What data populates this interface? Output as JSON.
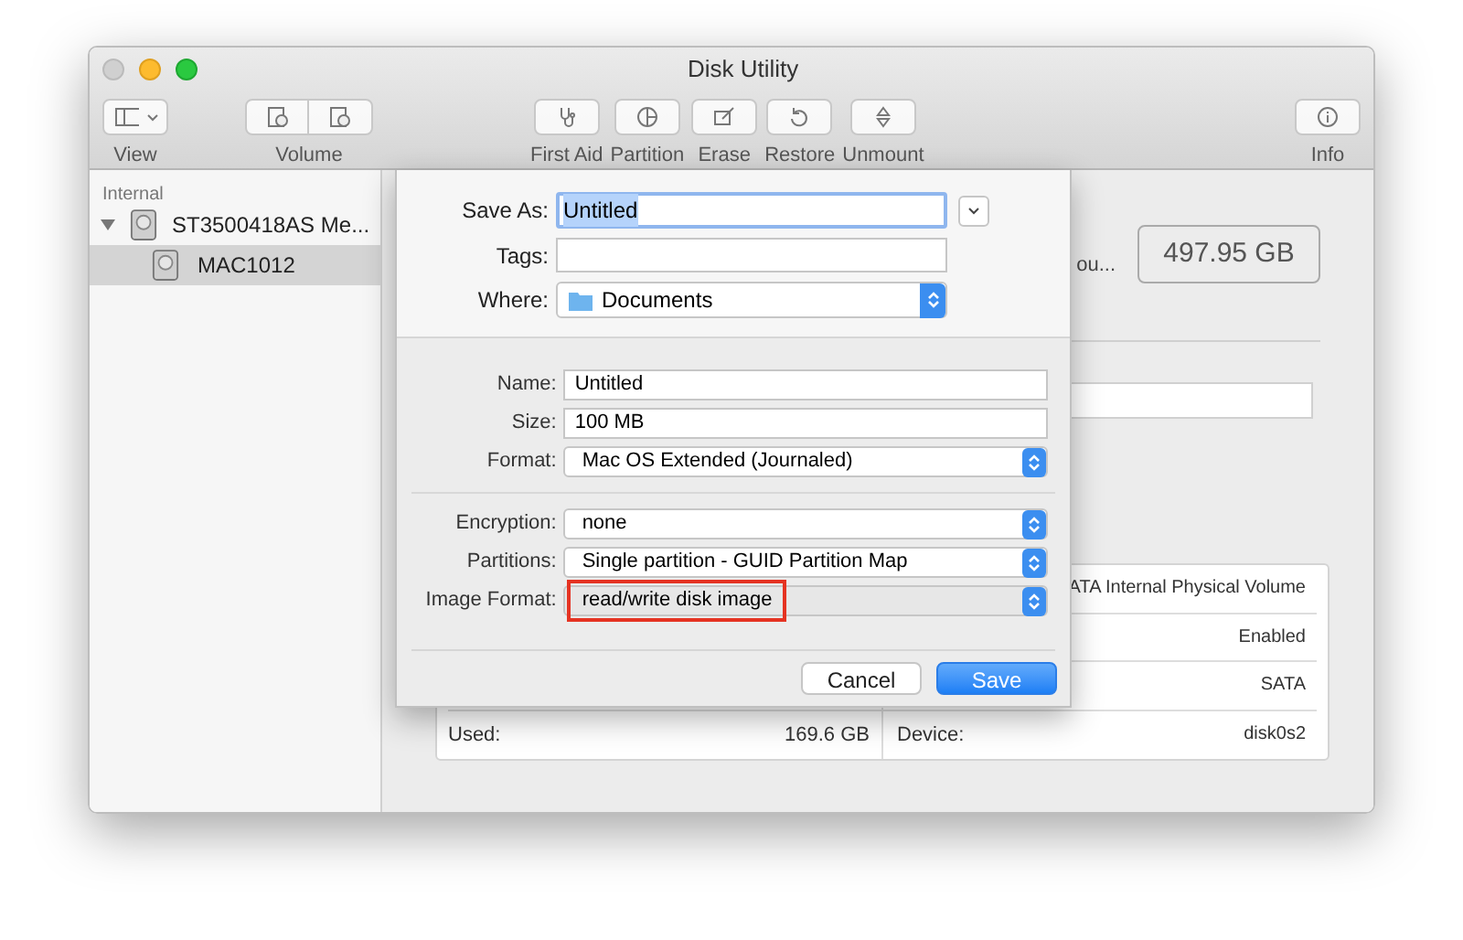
{
  "window": {
    "title": "Disk Utility"
  },
  "toolbar": {
    "left": [
      {
        "label": "View",
        "kind": "sidebar"
      },
      {
        "label": "Volume",
        "kind": "pair"
      }
    ],
    "center": [
      {
        "label": "First Aid",
        "kind": "stethoscope"
      },
      {
        "label": "Partition",
        "kind": "pie"
      },
      {
        "label": "Erase",
        "kind": "erase"
      },
      {
        "label": "Restore",
        "kind": "restore"
      },
      {
        "label": "Unmount",
        "kind": "eject"
      }
    ],
    "right": [
      {
        "label": "Info",
        "kind": "info"
      }
    ]
  },
  "sidebar": {
    "section": "Internal",
    "items": [
      {
        "label": "ST3500418AS Me...",
        "expanded": true,
        "selected": false,
        "children": [
          {
            "label": "MAC1012",
            "selected": true
          }
        ]
      }
    ]
  },
  "main": {
    "fragment": "ou...",
    "capacity": "497.95 GB",
    "info_rows": [
      {
        "left_label": "",
        "left_value": "",
        "right_label": "",
        "right_value": "ATA Internal Physical Volume"
      },
      {
        "left_label": "",
        "left_value": "",
        "right_label": "",
        "right_value": "Enabled"
      },
      {
        "left_label": "",
        "left_value": "",
        "right_label": "",
        "right_value": "SATA"
      },
      {
        "left_label": "Used:",
        "left_value": "169.6 GB",
        "right_label": "Device:",
        "right_value": "disk0s2"
      }
    ]
  },
  "dialog": {
    "save_as": {
      "label": "Save As:",
      "value": "Untitled"
    },
    "tags": {
      "label": "Tags:"
    },
    "where": {
      "label": "Where:",
      "value": "Documents"
    },
    "fields": [
      {
        "label": "Name:",
        "value": "Untitled",
        "kind": "text",
        "highlighted": false
      },
      {
        "label": "Size:",
        "value": "100 MB",
        "kind": "text",
        "highlighted": false
      },
      {
        "label": "Format:",
        "value": "Mac OS Extended (Journaled)",
        "kind": "popup",
        "highlighted": false
      },
      {
        "kind": "divider"
      },
      {
        "label": "Encryption:",
        "value": "none",
        "kind": "popup",
        "highlighted": false
      },
      {
        "label": "Partitions:",
        "value": "Single partition - GUID Partition Map",
        "kind": "popup",
        "highlighted": false
      },
      {
        "label": "Image Format:",
        "value": "read/write disk image",
        "kind": "popup",
        "highlighted": true
      }
    ],
    "buttons": [
      {
        "label": "Cancel",
        "default": false
      },
      {
        "label": "Save",
        "default": true
      }
    ]
  }
}
